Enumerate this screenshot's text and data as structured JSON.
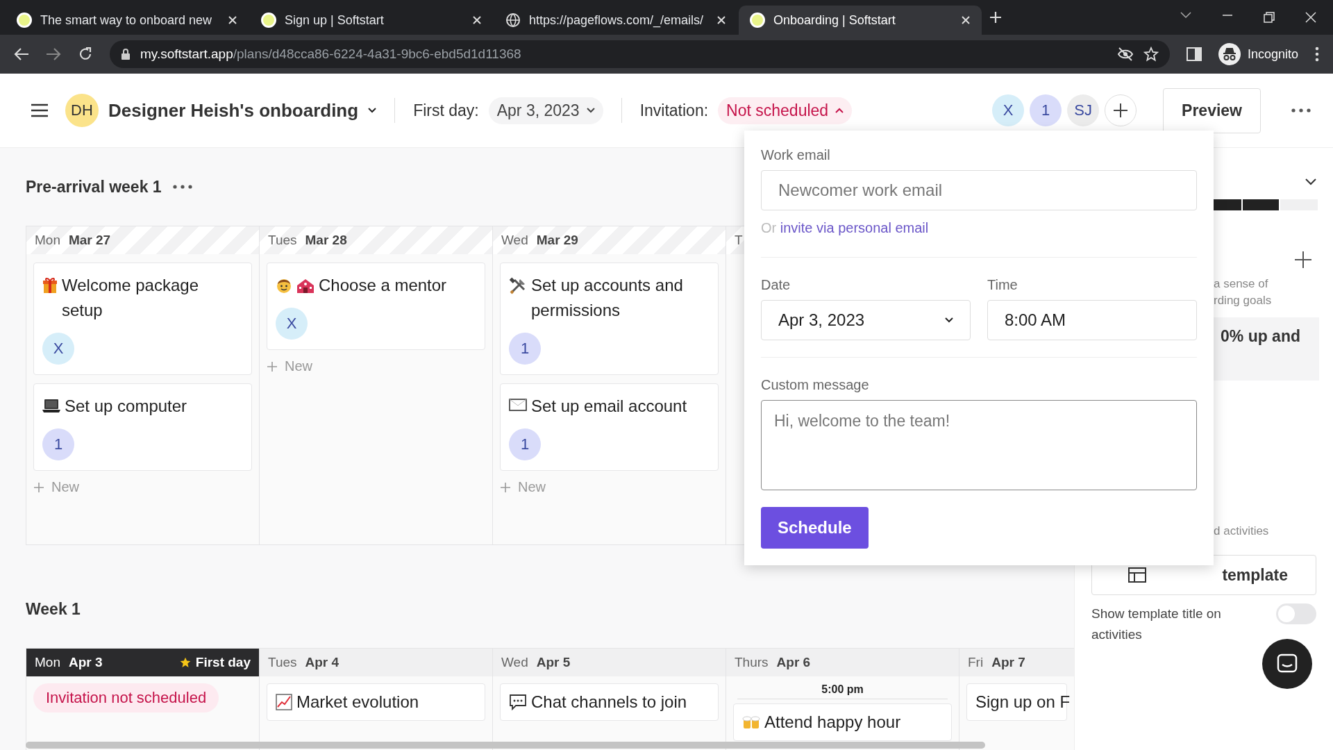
{
  "browser": {
    "tabs": [
      {
        "title": "The smart way to onboard new",
        "kind": "app",
        "selected": false
      },
      {
        "title": "Sign up | Softstart",
        "kind": "app",
        "selected": false
      },
      {
        "title": "https://pageflows.com/_/emails/",
        "kind": "web",
        "selected": false
      },
      {
        "title": "Onboarding | Softstart",
        "kind": "app",
        "selected": true
      }
    ],
    "url_host": "my.softstart.app",
    "url_path": "/plans/d48cca86-6224-4a31-9bc6-ebd5d1d11368",
    "profile": "Incognito"
  },
  "header": {
    "avatar": "DH",
    "title": "Designer Heish's onboarding",
    "first_day_label": "First day:",
    "first_day_value": "Apr 3, 2023",
    "invitation_label": "Invitation:",
    "invitation_value": "Not scheduled",
    "invitation_expanded": true,
    "collaborators": [
      {
        "label": "X",
        "color": "#d6eef9"
      },
      {
        "label": "1",
        "color": "#d9dcfa"
      },
      {
        "label": "SJ",
        "color": "#ececec"
      }
    ],
    "preview": "Preview"
  },
  "sections": [
    {
      "title": "Pre-arrival week 1",
      "days": [
        {
          "weekday": "Mon",
          "date": "Mar 27",
          "striped": true,
          "first_day": false,
          "cards": [
            {
              "title": "Welcome package setup",
              "assignee": {
                "label": "X",
                "color": "#d6eef9"
              }
            },
            {
              "title": "Set up computer",
              "assignee": {
                "label": "1",
                "color": "#d9dcfa"
              }
            }
          ],
          "new_label": "New"
        },
        {
          "weekday": "Tues",
          "date": "Mar 28",
          "striped": true,
          "first_day": false,
          "cards": [
            {
              "title": "Choose a mentor",
              "assignee": {
                "label": "X",
                "color": "#d6eef9"
              }
            }
          ],
          "new_label": "New"
        },
        {
          "weekday": "Wed",
          "date": "Mar 29",
          "striped": true,
          "first_day": false,
          "cards": [
            {
              "title": "Set up accounts and permissions",
              "assignee": {
                "label": "1",
                "color": "#d9dcfa"
              }
            },
            {
              "title": "Set up email account",
              "assignee": {
                "label": "1",
                "color": "#d9dcfa"
              }
            }
          ],
          "new_label": "New"
        },
        {
          "weekday": "T",
          "striped": true,
          "first_day": false
        }
      ]
    },
    {
      "title": "Week 1",
      "days": [
        {
          "weekday": "Mon",
          "date": "Apr 3",
          "striped": false,
          "first_day": true,
          "badge": "First day",
          "notice": "Invitation not scheduled"
        },
        {
          "weekday": "Tues",
          "date": "Apr 4",
          "striped": false,
          "first_day": false,
          "cards": [
            {
              "title": "Market evolution"
            }
          ]
        },
        {
          "weekday": "Wed",
          "date": "Apr 5",
          "striped": false,
          "first_day": false,
          "cards": [
            {
              "title": "Chat channels to join"
            }
          ]
        },
        {
          "weekday": "Thurs",
          "date": "Apr 6",
          "striped": false,
          "first_day": false,
          "time_label": "5:00 pm",
          "cards": [
            {
              "title": "Attend happy hour"
            }
          ]
        },
        {
          "weekday": "Fri",
          "date": "Apr 7",
          "striped": false,
          "first_day": false,
          "cards": [
            {
              "title": "Sign up on F"
            }
          ]
        }
      ]
    }
  ],
  "popup": {
    "work_email_label": "Work email",
    "work_email_placeholder": "Newcomer work email",
    "alt_prefix": "Or",
    "alt_link": "invite via personal email",
    "date_label": "Date",
    "date_value": "Apr 3, 2023",
    "time_label": "Time",
    "time_value": "8:00 AM",
    "message_label": "Custom message",
    "message_placeholder": "Hi, welcome to the team!",
    "button": "Schedule"
  },
  "side_panel": {
    "goal_text_1": "a sense of",
    "goal_text_2": "rding goals",
    "goal_card": "0% up and",
    "activities_text": "d activities",
    "template_button": "template",
    "toggle_label": "Show template title on activities",
    "toggle_on": false
  }
}
